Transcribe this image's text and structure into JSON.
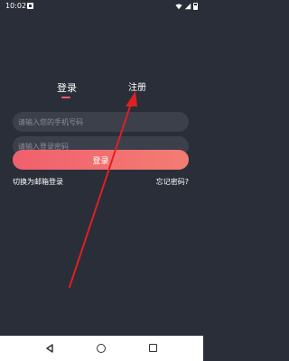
{
  "status": {
    "time": "10:02"
  },
  "tabs": {
    "login": "登录",
    "register": "注册"
  },
  "form": {
    "phone_placeholder": "请输入您的手机号码",
    "password_placeholder": "请输入登录密码",
    "login_button": "登录"
  },
  "links": {
    "email_login": "切换为邮箱登录",
    "forgot_password": "忘记密码?"
  },
  "colors": {
    "background": "#2a2e38",
    "accent": "#f25c6b",
    "annotation": "#e02020"
  },
  "icons": [
    "notification-icon",
    "wifi-icon",
    "signal-icon",
    "battery-icon",
    "nav-back-icon",
    "nav-home-icon",
    "nav-recent-icon"
  ]
}
